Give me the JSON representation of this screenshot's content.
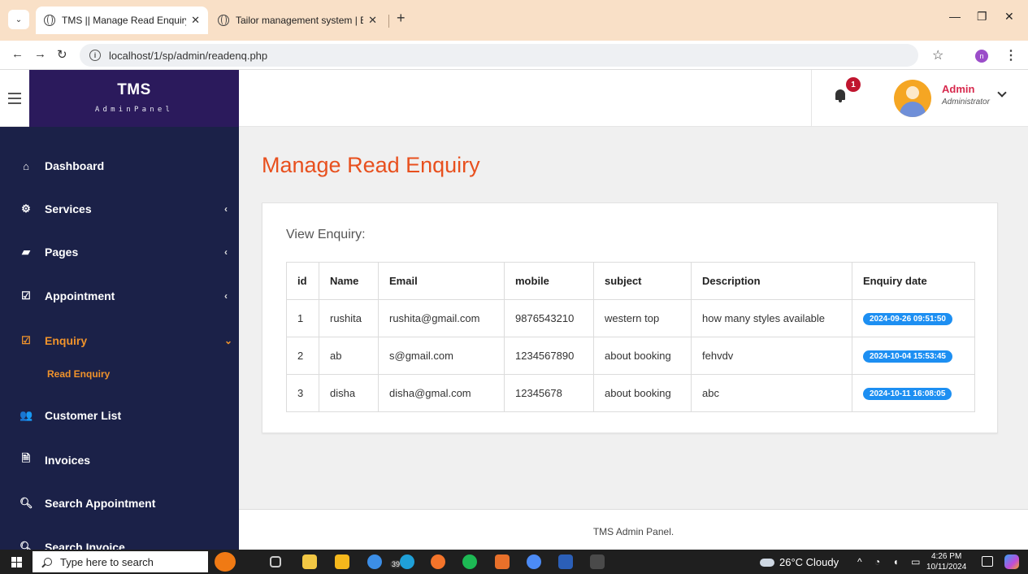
{
  "browser": {
    "tabs": [
      {
        "title": "TMS || Manage Read Enquiry",
        "active": true
      },
      {
        "title": "Tailor management system | Enq",
        "active": false
      }
    ],
    "url": "localhost/1/sp/admin/readenq.php",
    "profile_initial": "n"
  },
  "header": {
    "brand_title": "TMS",
    "brand_subtitle": "AdminPanel",
    "notification_count": "1",
    "user_name": "Admin",
    "user_role": "Administrator"
  },
  "sidebar": {
    "items": [
      {
        "label": "Dashboard",
        "icon": "home-icon",
        "has_arrow": false
      },
      {
        "label": "Services",
        "icon": "cogs-icon",
        "has_arrow": true
      },
      {
        "label": "Pages",
        "icon": "book-icon",
        "has_arrow": true
      },
      {
        "label": "Appointment",
        "icon": "checkbox-icon",
        "has_arrow": true
      },
      {
        "label": "Enquiry",
        "icon": "checkbox-icon",
        "has_arrow": true,
        "active": true
      },
      {
        "label": "Customer List",
        "icon": "users-icon",
        "has_arrow": false
      },
      {
        "label": "Invoices",
        "icon": "file-icon",
        "has_arrow": false
      },
      {
        "label": "Search Appointment",
        "icon": "search-icon",
        "has_arrow": false
      },
      {
        "label": "Search Invoice",
        "icon": "search-icon",
        "has_arrow": false
      }
    ],
    "sub_item": "Read Enquiry",
    "active_color": "#f0932b"
  },
  "main": {
    "page_title": "Manage Read Enquiry",
    "card_title": "View Enquiry:",
    "table": {
      "columns": [
        "id",
        "Name",
        "Email",
        "mobile",
        "subject",
        "Description",
        "Enquiry date"
      ],
      "rows": [
        [
          "1",
          "rushita",
          "rushita@gmail.com",
          "9876543210",
          "western top",
          "how many styles available",
          "2024-09-26 09:51:50"
        ],
        [
          "2",
          "ab",
          "s@gmail.com",
          "1234567890",
          "about booking",
          "fehvdv",
          "2024-10-04 15:53:45"
        ],
        [
          "3",
          "disha",
          "disha@gmal.com",
          "12345678",
          "about booking",
          "abc",
          "2024-10-11 16:08:05"
        ]
      ]
    },
    "title_color": "#e8501e",
    "badge_color": "#1d8ff2"
  },
  "footer": {
    "text": "TMS Admin Panel."
  },
  "taskbar": {
    "search_placeholder": "Type here to search",
    "badge_count": "39",
    "weather": "26°C  Cloudy",
    "time": "4:26 PM",
    "date": "10/11/2024"
  }
}
